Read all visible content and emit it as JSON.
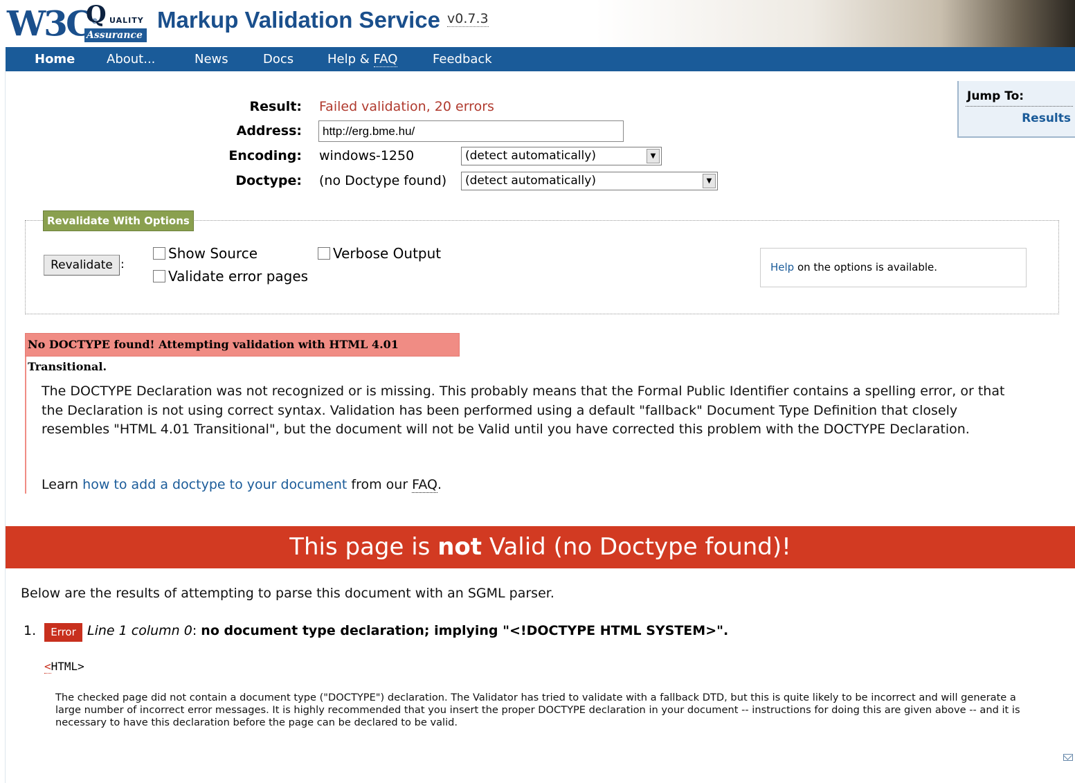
{
  "banner": {
    "w3c_logo": "W3C",
    "qa_logo_q": "Q",
    "qa_logo_quality": "UALITY",
    "qa_logo_assurance": "Assurance",
    "title": "Markup Validation Service",
    "version": "v0.7.3"
  },
  "nav": {
    "items": [
      {
        "label": "Home",
        "active": true
      },
      {
        "label": "About...",
        "active": false
      },
      {
        "label": "News",
        "active": false
      },
      {
        "label": "Docs",
        "active": false
      },
      {
        "label": "Help & FAQ",
        "active": false
      },
      {
        "label": "Feedback",
        "active": false
      }
    ],
    "help_label": "Help",
    "faq_label": "FAQ",
    "amp": " & "
  },
  "jump_to": {
    "title": "Jump To:",
    "results_link": "Results"
  },
  "summary": {
    "result_label": "Result:",
    "result_value": "Failed validation, 20 errors",
    "address_label": "Address:",
    "address_value": "http://erg.bme.hu/",
    "encoding_label": "Encoding:",
    "encoding_value": "windows-1250",
    "encoding_select": "(detect automatically)",
    "doctype_label": "Doctype:",
    "doctype_value": "(no Doctype found)",
    "doctype_select": "(detect automatically)"
  },
  "options": {
    "legend": "Revalidate With Options",
    "revalidate_button": "Revalidate",
    "colon": ":",
    "show_source": "Show Source",
    "verbose_output": "Verbose Output",
    "validate_error_pages": "Validate error pages",
    "help_link": "Help",
    "help_text": " on the options is available."
  },
  "doctype_warning": {
    "heading": "No DOCTYPE found! Attempting validation with HTML 4.01 Transitional.",
    "paragraph": "The DOCTYPE Declaration was not recognized or is missing. This probably means that the Formal Public Identifier contains a spelling error, or that the Declaration is not using correct syntax. Validation has been performed using a default \"fallback\" Document Type Definition that closely resembles \"HTML 4.01 Transitional\", but the document will not be Valid until you have corrected this problem with the DOCTYPE Declaration.",
    "learn_prefix": "Learn ",
    "learn_link": "how to add a doctype to your document",
    "learn_middle": " from our ",
    "learn_faq": "FAQ",
    "learn_suffix": "."
  },
  "invalid_banner": {
    "prefix": "This page is ",
    "emphasis": "not",
    "suffix": " Valid (no Doctype found)!"
  },
  "results": {
    "intro": "Below are the results of attempting to parse this document with an SGML parser.",
    "errors": [
      {
        "number": "1.",
        "badge": "Error",
        "location": "Line 1 column 0",
        "separator": ": ",
        "message": "no document type declaration; implying \"<!DOCTYPE HTML SYSTEM>\".",
        "code_lt": "<",
        "code_rest": "HTML>",
        "explanation": "The checked page did not contain a document type (\"DOCTYPE\") declaration. The Validator has tried to validate with a fallback DTD, but this is quite likely to be incorrect and will generate a large number of incorrect error messages. It is highly recommended that you insert the proper DOCTYPE declaration in your document -- instructions for doing this are given above -- and it is necessary to have this declaration before the page can be declared to be valid."
      }
    ]
  },
  "colors": {
    "brand_blue": "#1a5b99",
    "error_red": "#d23a22",
    "warning_pink": "#f08c84",
    "legend_green": "#8aa04f"
  },
  "icons": {
    "feedback": "mail-icon"
  }
}
